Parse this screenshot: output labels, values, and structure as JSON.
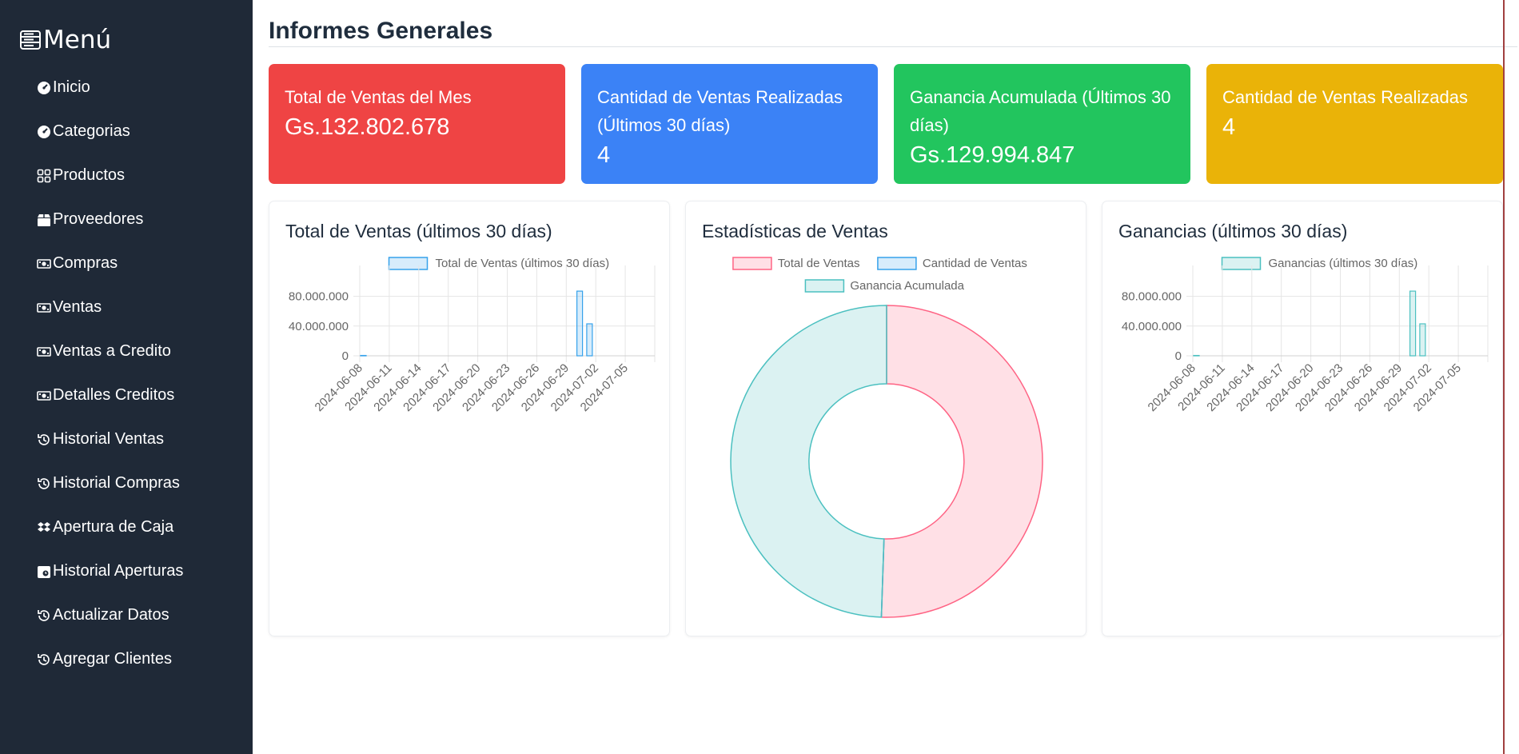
{
  "sidebar": {
    "title": "Menú",
    "items": [
      {
        "label": "Inicio",
        "icon": "dashboard-icon"
      },
      {
        "label": "Categorias",
        "icon": "dashboard-icon"
      },
      {
        "label": "Productos",
        "icon": "grid-icon"
      },
      {
        "label": "Proveedores",
        "icon": "box-icon"
      },
      {
        "label": "Compras",
        "icon": "cash-icon"
      },
      {
        "label": "Ventas",
        "icon": "cash-icon"
      },
      {
        "label": "Ventas a Credito",
        "icon": "cash-icon"
      },
      {
        "label": "Detalles Creditos",
        "icon": "cash-icon"
      },
      {
        "label": "Historial Ventas",
        "icon": "history-icon"
      },
      {
        "label": "Historial Compras",
        "icon": "history-icon"
      },
      {
        "label": "Apertura de Caja",
        "icon": "dropbox-icon"
      },
      {
        "label": "Historial Aperturas",
        "icon": "calendar-clock-icon"
      },
      {
        "label": "Actualizar Datos",
        "icon": "history-icon"
      },
      {
        "label": "Agregar Clientes",
        "icon": "history-icon"
      }
    ]
  },
  "main": {
    "title": "Informes Generales",
    "cards": [
      {
        "title": "Total de Ventas del Mes",
        "value": "Gs.132.802.678",
        "color": "#ef4444"
      },
      {
        "title": "Cantidad de Ventas Realizadas (Últimos 30 días)",
        "value": "4",
        "color": "#3b82f6"
      },
      {
        "title": "Ganancia Acumulada (Últimos 30 días)",
        "value": "Gs.129.994.847",
        "color": "#22c55e"
      },
      {
        "title": "Cantidad de Ventas Realizadas",
        "value": "4",
        "color": "#eab308"
      }
    ],
    "panels": [
      {
        "title": "Total de Ventas (últimos 30 días)"
      },
      {
        "title": "Estadísticas de Ventas"
      },
      {
        "title": "Ganancias (últimos 30 días)"
      }
    ]
  },
  "chart_data": [
    {
      "type": "bar",
      "series": [
        {
          "name": "Total de Ventas (últimos 30 días)",
          "color": "#36a2eb",
          "points": [
            {
              "x": "2024-06-08",
              "y": 500000
            },
            {
              "x": "2024-06-30",
              "y": 87000000
            },
            {
              "x": "2024-07-01",
              "y": 43000000
            }
          ]
        }
      ],
      "x_ticks": [
        "2024-06-08",
        "2024-06-11",
        "2024-06-14",
        "2024-06-17",
        "2024-06-20",
        "2024-06-23",
        "2024-06-26",
        "2024-06-29",
        "2024-07-02",
        "2024-07-05"
      ],
      "y_ticks": [
        "0",
        "40.000.000",
        "80.000.000"
      ],
      "ylim": [
        0,
        100000000
      ],
      "xlim": [
        "2024-06-08",
        "2024-07-08"
      ],
      "grid": true,
      "legend": "top"
    },
    {
      "type": "pie",
      "legend": [
        "Total de Ventas",
        "Cantidad de Ventas",
        "Ganancia Acumulada"
      ],
      "labels": [
        "Total de Ventas",
        "Cantidad de Ventas",
        "Ganancia Acumulada"
      ],
      "values": [
        132802678,
        4,
        129994847
      ],
      "colors": [
        "#ff6384",
        "#36a2eb",
        "#4bc0c0"
      ]
    },
    {
      "type": "bar",
      "series": [
        {
          "name": "Ganancias (últimos 30 días)",
          "color": "#4bc0c0",
          "points": [
            {
              "x": "2024-06-08",
              "y": 500000
            },
            {
              "x": "2024-06-30",
              "y": 87000000
            },
            {
              "x": "2024-07-01",
              "y": 43000000
            }
          ]
        }
      ],
      "x_ticks": [
        "2024-06-08",
        "2024-06-11",
        "2024-06-14",
        "2024-06-17",
        "2024-06-20",
        "2024-06-23",
        "2024-06-26",
        "2024-06-29",
        "2024-07-02",
        "2024-07-05"
      ],
      "y_ticks": [
        "0",
        "40.000.000",
        "80.000.000"
      ],
      "ylim": [
        0,
        100000000
      ],
      "xlim": [
        "2024-06-08",
        "2024-07-08"
      ],
      "grid": true,
      "legend": "top"
    }
  ]
}
